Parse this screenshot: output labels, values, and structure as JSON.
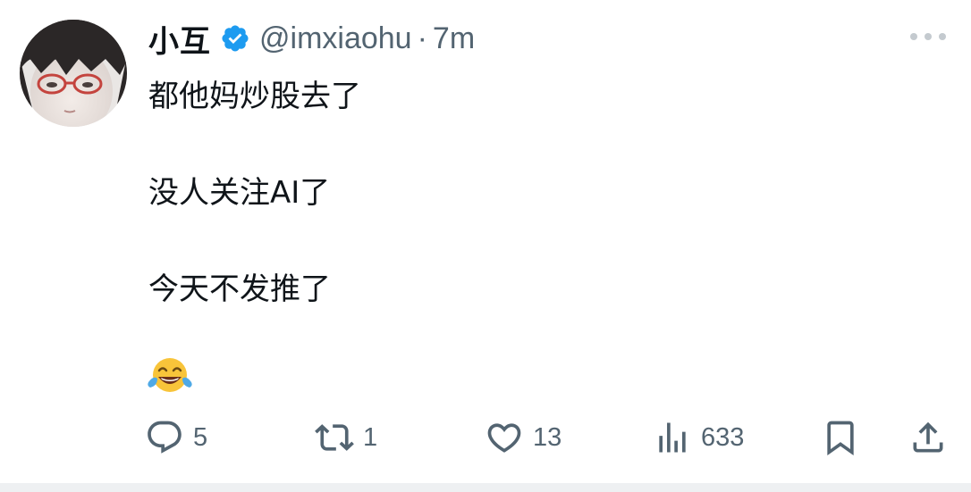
{
  "tweet": {
    "display_name": "小互",
    "handle": "@imxiaohu",
    "separator": "·",
    "time": "7m",
    "lines": [
      "都他妈炒股去了",
      "没人关注AI了",
      "今天不发推了"
    ],
    "emoji_icon": "face-with-tears-of-joy-icon"
  },
  "actions": {
    "reply_count": "5",
    "repost_count": "1",
    "like_count": "13",
    "views_count": "633"
  },
  "colors": {
    "verified_blue": "#1d9bf0",
    "text_primary": "#0f1419",
    "text_secondary": "#536471"
  }
}
